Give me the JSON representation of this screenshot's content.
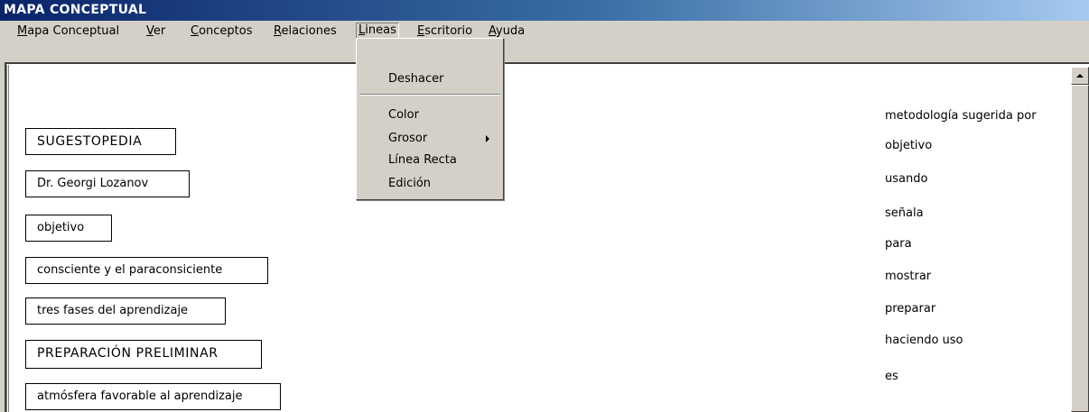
{
  "window": {
    "title": "MAPA CONCEPTUAL"
  },
  "menubar": {
    "items": [
      {
        "key": "M",
        "rest": "apa Conceptual"
      },
      {
        "key": "V",
        "rest": "er"
      },
      {
        "key": "C",
        "rest": "onceptos"
      },
      {
        "key": "R",
        "rest": "elaciones"
      },
      {
        "key": "L",
        "rest": "ineas"
      },
      {
        "key": "E",
        "rest": "scritorio"
      },
      {
        "key": "A",
        "rest": "yuda"
      }
    ]
  },
  "lineas_menu": {
    "undo": "Deshacer",
    "color": "Color",
    "thickness": "Grosor",
    "straight_line": "Línea Recta",
    "edit": "Edición"
  },
  "concepts": [
    "SUGESTOPEDIA",
    "Dr. Georgi Lozanov",
    "objetivo",
    "consciente y el paraconsiciente",
    "tres fases del aprendizaje",
    "PREPARACIÓN PRELIMINAR",
    "atmósfera favorable al aprendizaje"
  ],
  "relations": [
    "metodología sugerida por",
    "objetivo",
    "usando",
    "señala",
    "para",
    "mostrar",
    "preparar",
    "haciendo uso",
    "es"
  ],
  "icons": {
    "scroll_up": "arrow-up-icon",
    "submenu": "chevron-right-icon"
  }
}
